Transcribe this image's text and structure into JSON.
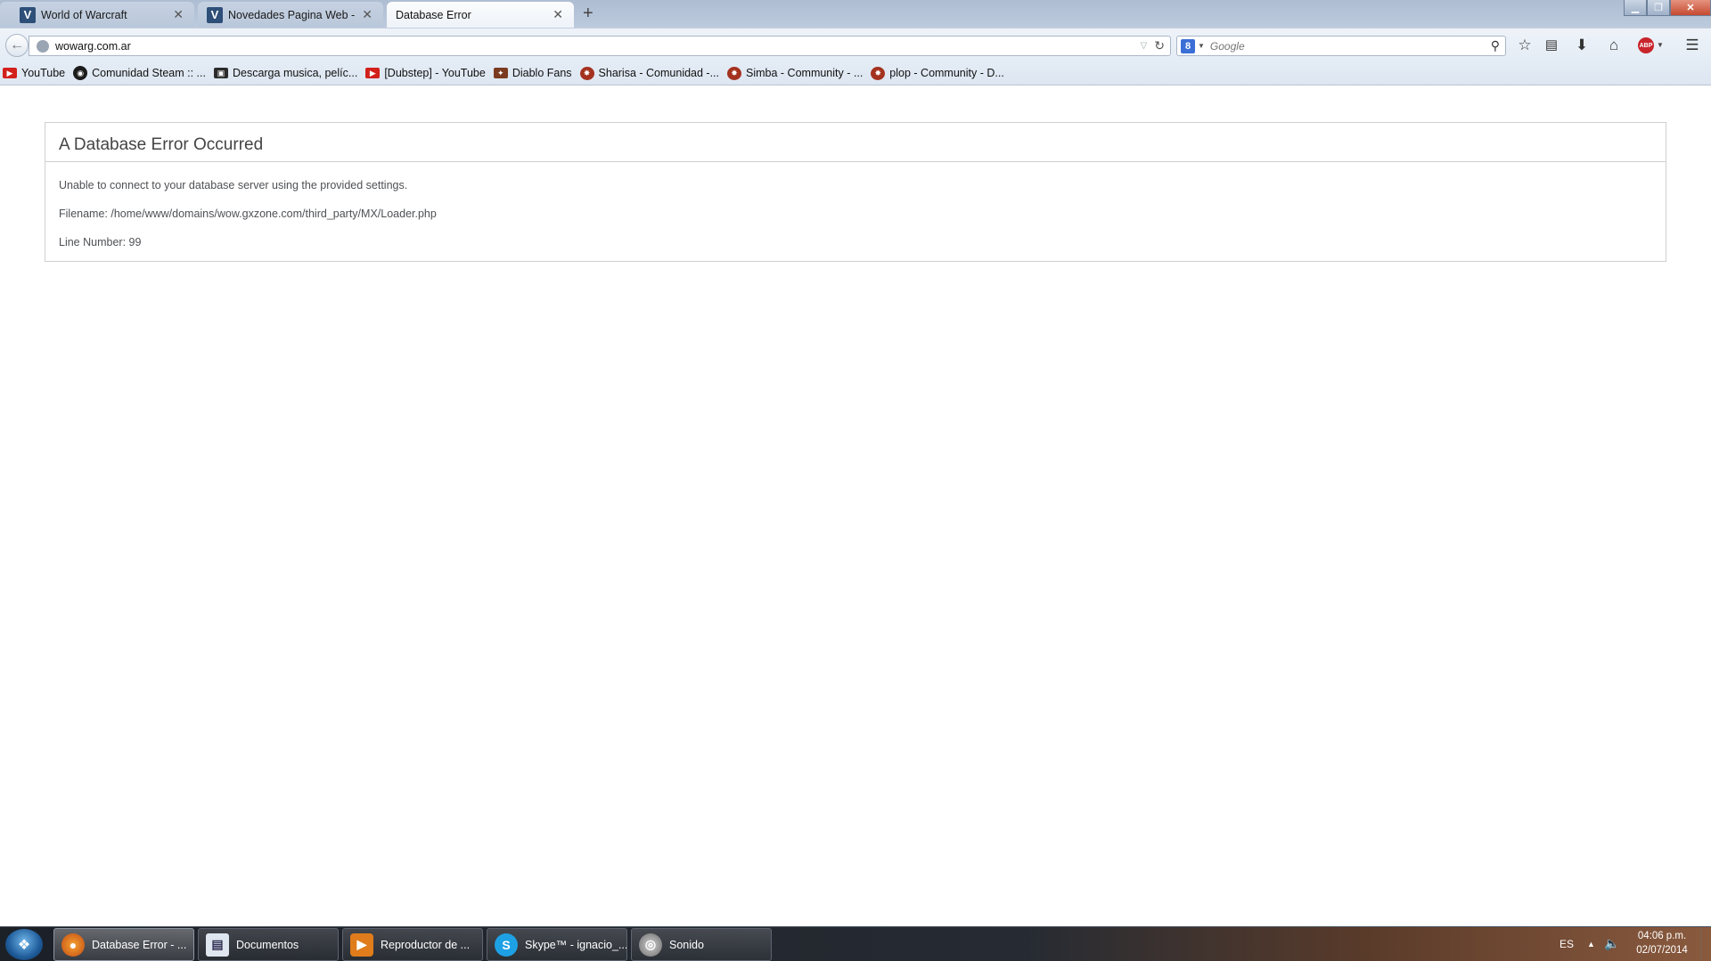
{
  "browser": {
    "tabs": [
      {
        "label": "World of Warcraft",
        "favicon": "V",
        "active": false
      },
      {
        "label": "Novedades Pagina Web - ...",
        "favicon": "V",
        "active": false
      },
      {
        "label": "Database Error",
        "favicon": "",
        "active": true
      }
    ],
    "new_tab": "+",
    "url": "wowarg.com.ar",
    "search_engine_letter": "8",
    "search_placeholder": "Google",
    "bookmarks": [
      {
        "label": "YouTube",
        "icon": "youtube-icon"
      },
      {
        "label": "Comunidad Steam :: ...",
        "icon": "steam-icon"
      },
      {
        "label": "Descarga musica, pelíc...",
        "icon": "download-icon"
      },
      {
        "label": "[Dubstep] - YouTube",
        "icon": "youtube-icon"
      },
      {
        "label": "Diablo Fans",
        "icon": "diablo-icon"
      },
      {
        "label": "Sharisa - Comunidad -...",
        "icon": "dota-icon"
      },
      {
        "label": "Simba - Community - ...",
        "icon": "dota-icon"
      },
      {
        "label": "plop - Community - D...",
        "icon": "dota-icon"
      }
    ],
    "abp_label": "ABP"
  },
  "page": {
    "title": "A Database Error Occurred",
    "message": "Unable to connect to your database server using the provided settings.",
    "filename": "Filename: /home/www/domains/wow.gxzone.com/third_party/MX/Loader.php",
    "line_number": "Line Number: 99"
  },
  "taskbar": {
    "items": [
      {
        "label": "Database Error - ...",
        "icon": "firefox-icon",
        "active": true
      },
      {
        "label": "Documentos",
        "icon": "documents-icon",
        "active": false
      },
      {
        "label": "Reproductor de ...",
        "icon": "media-player-icon",
        "active": false
      },
      {
        "label": "Skype™ - ignacio_...",
        "icon": "skype-icon",
        "active": false
      },
      {
        "label": "Sonido",
        "icon": "sound-icon",
        "active": false
      }
    ],
    "language": "ES",
    "time": "04:06 p.m.",
    "date": "02/07/2014"
  }
}
